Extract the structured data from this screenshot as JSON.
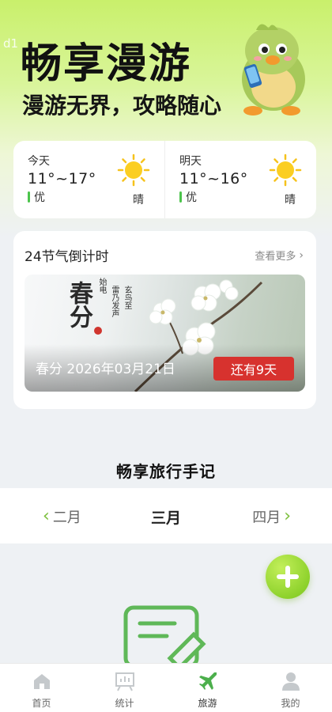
{
  "watermark": "d1",
  "hero": {
    "title": "畅享漫游",
    "subtitle": "漫游无界，攻略随心"
  },
  "weather": {
    "today": {
      "label": "今天",
      "temp": "11°~17°",
      "air_quality": "优",
      "condition": "晴",
      "icon": "sun-icon"
    },
    "tomorrow": {
      "label": "明天",
      "temp": "11°~16°",
      "air_quality": "优",
      "condition": "晴",
      "icon": "sun-icon"
    },
    "air_quality_color": "#4cc44c"
  },
  "solar_terms": {
    "title": "24节气倒计时",
    "more_label": "查看更多",
    "banner": {
      "term_art": "春分",
      "poem_lines": [
        "玄鸟至",
        "雷乃发声",
        "始电"
      ],
      "date_text": "春分  2026年03月21日",
      "countdown": "还有9天",
      "countdown_color": "#d7322e"
    }
  },
  "travel_notes": {
    "title": "畅享旅行手记",
    "months": {
      "prev": "二月",
      "current": "三月",
      "next": "四月"
    },
    "accent_color": "#7cbf3c"
  },
  "tabs": [
    {
      "label": "首页",
      "icon": "home-icon"
    },
    {
      "label": "统计",
      "icon": "chart-board-icon"
    },
    {
      "label": "旅游",
      "icon": "airplane-icon",
      "active": true
    },
    {
      "label": "我的",
      "icon": "user-icon"
    }
  ]
}
